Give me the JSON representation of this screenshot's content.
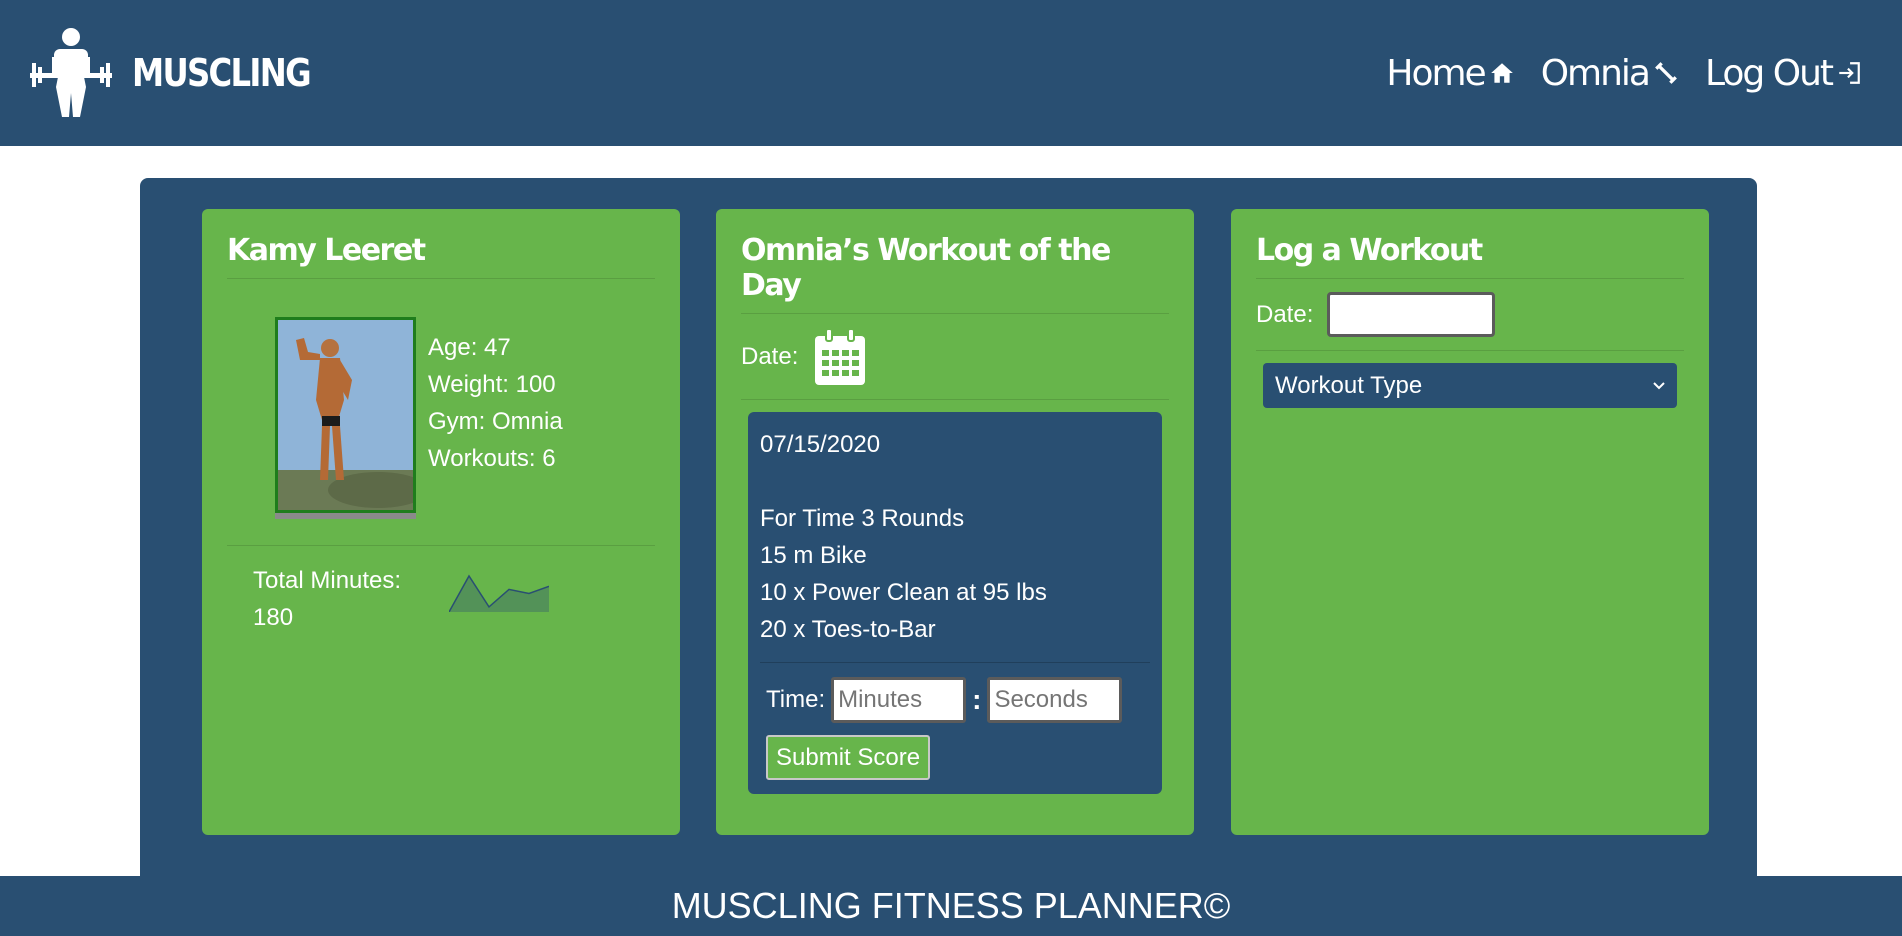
{
  "brand": {
    "name": "MUSCLING",
    "logo_icon": "weightlifter-icon"
  },
  "nav": {
    "items": [
      {
        "label": "Home",
        "icon": "home-icon"
      },
      {
        "label": "Omnia",
        "icon": "dumbbell-icon"
      },
      {
        "label": "Log Out",
        "icon": "logout-icon"
      }
    ]
  },
  "profile": {
    "name": "Kamy Leeret",
    "age": "Age: 47",
    "weight": "Weight: 100",
    "gym": "Gym: Omnia",
    "workouts": "Workouts: 6",
    "total_minutes_label": "Total Minutes:",
    "total_minutes_value": "180",
    "sparkline_values": [
      0,
      35,
      5,
      22,
      18,
      25
    ]
  },
  "wod": {
    "title": "Omnia’s Workout of the Day",
    "date_label": "Date:",
    "date_icon": "calendar-icon",
    "date": "07/15/2020",
    "lines": [
      "For Time 3 Rounds",
      "15 m Bike",
      "10 x Power Clean at 95 lbs",
      "20 x Toes-to-Bar"
    ],
    "time_label": "Time:",
    "minutes_placeholder": "Minutes",
    "seconds_placeholder": "Seconds",
    "colon": ":",
    "submit_label": "Submit Score"
  },
  "log": {
    "title": "Log a Workout",
    "date_label": "Date:",
    "workout_type_selected": "Workout Type"
  },
  "footer": {
    "text": "MUSCLING FITNESS PLANNER©"
  },
  "colors": {
    "navy": "#294f72",
    "green": "#67b54b"
  }
}
